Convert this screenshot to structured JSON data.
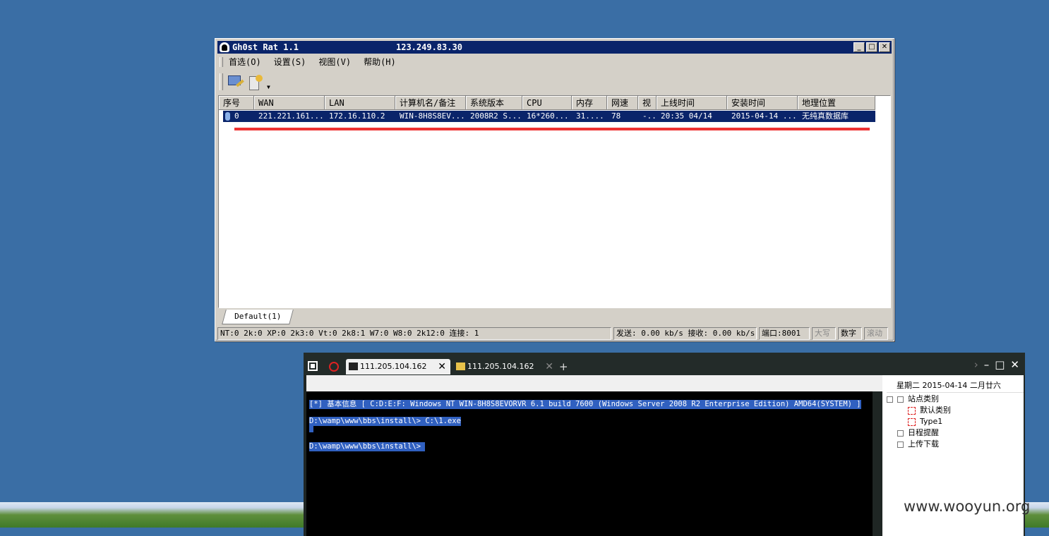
{
  "ghost": {
    "title": "Gh0st Rat 1.1",
    "ip": "123.249.83.30",
    "controls": {
      "min": "_",
      "max": "□",
      "close": "✕"
    },
    "menu": [
      "首选(O)",
      "设置(S)",
      "视图(V)",
      "帮助(H)"
    ],
    "columns": [
      "序号",
      "WAN",
      "LAN",
      "计算机名/备注",
      "系统版本",
      "CPU",
      "内存",
      "网速",
      "视",
      "上线时间",
      "安装时间",
      "地理位置"
    ],
    "row": [
      "0",
      "221.221.161...",
      "172.16.110.2",
      "WIN-8H8S8EV...",
      "2008R2 S...",
      "16*260...",
      "31....",
      "78",
      "-..",
      "20:35 04/14",
      "2015-04-14 ...",
      "无纯真数据库"
    ],
    "tab": "Default(1)",
    "status": {
      "os_counts": "NT:0 2k:0 XP:0 2k3:0 Vt:0 2k8:1 W7:0 W8:0 2k12:0  连接: 1",
      "traffic": "发送: 0.00 kb/s 接收: 0.00 kb/s",
      "port": "端口:8001",
      "caps": "大写",
      "num": "数字",
      "scroll": "滚动"
    }
  },
  "terminal": {
    "tab_active": "111.205.104.162",
    "tab_inactive": "111.205.104.162",
    "lines": [
      "[*] 基本信息 [ C:D:E:F: Windows NT WIN-8H8S8EVORVR 6.1 build 7600 (Windows Server 2008 R2 Enterprise Edition) AMD64(SYSTEM) ]",
      "D:\\wamp\\www\\bbs\\install\\> C:\\1.exe",
      "D:\\wamp\\www\\bbs\\install\\> "
    ]
  },
  "side": {
    "date": "星期二 2015-04-14 二月廿六",
    "tree": {
      "site_category": "站点类别",
      "default_category": "默认类别",
      "type1": "Type1",
      "reminder": "日程提醒",
      "upload_download": "上传下载"
    }
  },
  "watermark": "www.wooyun.org"
}
